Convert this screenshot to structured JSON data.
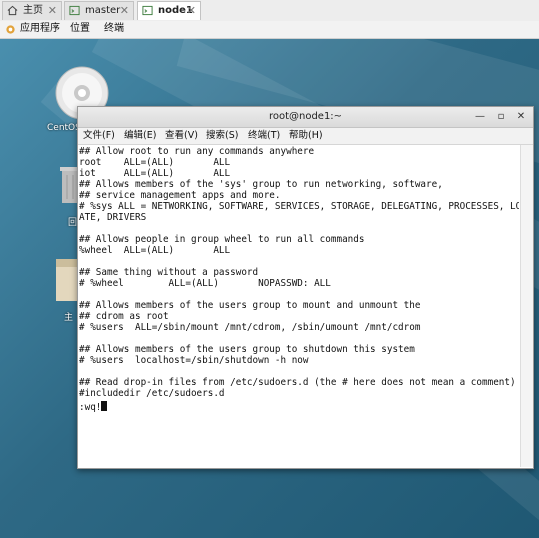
{
  "tabs": [
    {
      "label": "主页",
      "icon": "home-icon"
    },
    {
      "label": "master",
      "icon": "terminal-tab-icon"
    },
    {
      "label": "node1",
      "icon": "terminal-tab-icon"
    }
  ],
  "app_menu": [
    "应用程序",
    "位置",
    "终端"
  ],
  "desktop": {
    "icons": [
      {
        "label": "CentOS",
        "icon": "cd-disc-icon"
      },
      {
        "label": "回",
        "icon": "trash-icon"
      },
      {
        "label": "主",
        "icon": "home-folder-icon"
      }
    ]
  },
  "terminal": {
    "title": "root@node1:~",
    "menu": [
      "文件(F)",
      "编辑(E)",
      "查看(V)",
      "搜索(S)",
      "终端(T)",
      "帮助(H)"
    ],
    "lines": [
      "## Allow root to run any commands anywhere",
      "root    ALL=(ALL)       ALL",
      "iot     ALL=(ALL)       ALL",
      "## Allows members of the 'sys' group to run networking, software,",
      "## service management apps and more.",
      "# %sys ALL = NETWORKING, SOFTWARE, SERVICES, STORAGE, DELEGATING, PROCESSES, LOC",
      "ATE, DRIVERS",
      "",
      "## Allows people in group wheel to run all commands",
      "%wheel  ALL=(ALL)       ALL",
      "",
      "## Same thing without a password",
      "# %wheel        ALL=(ALL)       NOPASSWD: ALL",
      "",
      "## Allows members of the users group to mount and unmount the",
      "## cdrom as root",
      "# %users  ALL=/sbin/mount /mnt/cdrom, /sbin/umount /mnt/cdrom",
      "",
      "## Allows members of the users group to shutdown this system",
      "# %users  localhost=/sbin/shutdown -h now",
      "",
      "## Read drop-in files from /etc/sudoers.d (the # here does not mean a comment)",
      "#includedir /etc/sudoers.d"
    ],
    "command": ":wq!"
  }
}
